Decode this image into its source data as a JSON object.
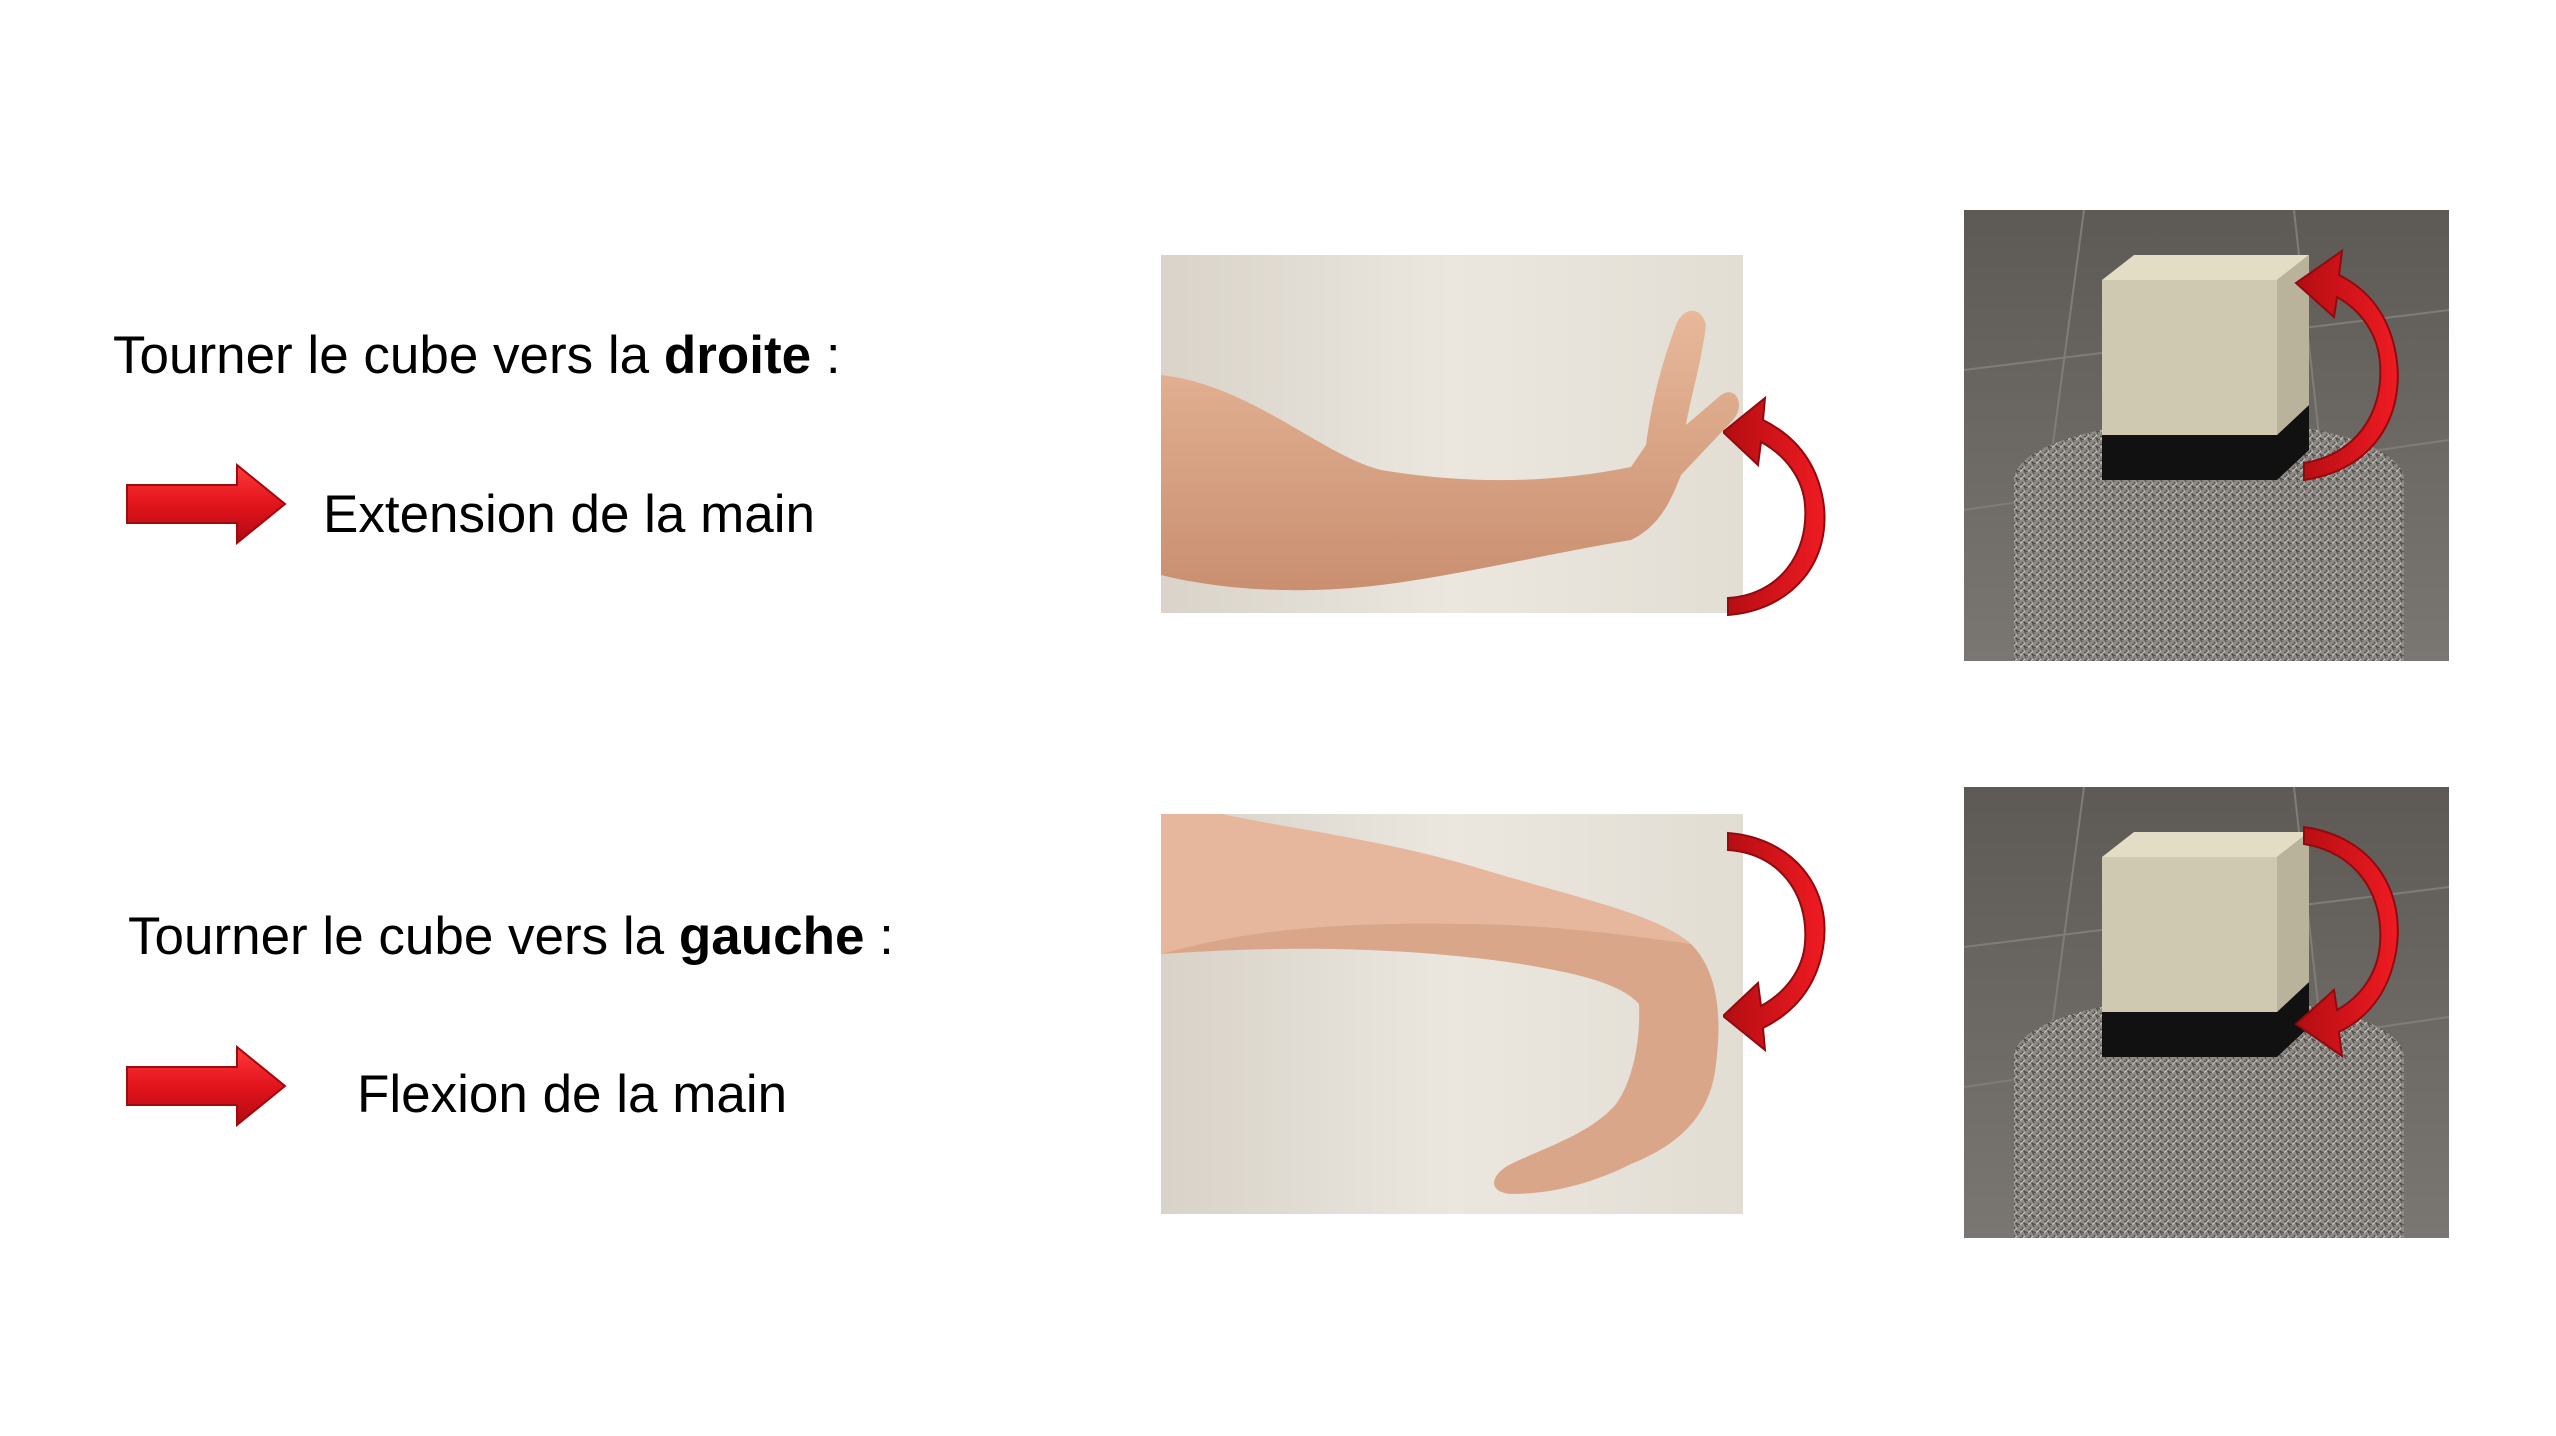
{
  "colors": {
    "arrow_red": "#e2141c",
    "background": "#ffffff",
    "cube": "#cfc9b1",
    "floor": "#6e6a66"
  },
  "rows": [
    {
      "instruction_prefix": "Tourner le cube vers la ",
      "instruction_bold": "droite",
      "instruction_suffix": " :",
      "movement": "Extension de la main",
      "icon": "right-arrow-icon",
      "hand_pose": "wrist-extension",
      "rotation_arrow": "curved-arrow-up-icon"
    },
    {
      "instruction_prefix": "Tourner le cube vers la ",
      "instruction_bold": "gauche",
      "instruction_suffix": " :",
      "movement": "Flexion de la main",
      "icon": "right-arrow-icon",
      "hand_pose": "wrist-flexion",
      "rotation_arrow": "curved-arrow-down-icon"
    }
  ]
}
